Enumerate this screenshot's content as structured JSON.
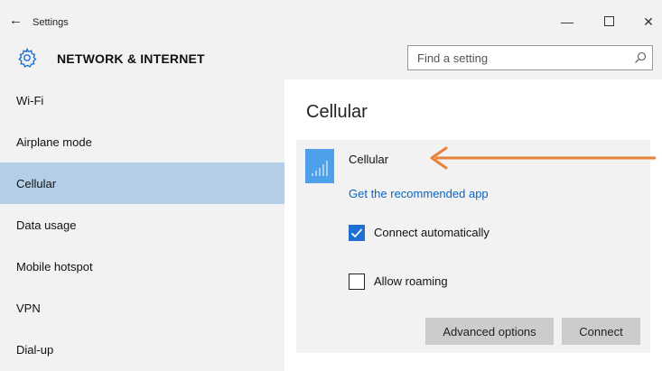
{
  "window": {
    "title": "Settings",
    "back_glyph": "←",
    "minimize_glyph": "—",
    "close_glyph": "✕"
  },
  "header": {
    "section_title": "NETWORK & INTERNET",
    "search_placeholder": "Find a setting"
  },
  "sidebar": {
    "items": [
      {
        "label": "Wi-Fi"
      },
      {
        "label": "Airplane mode"
      },
      {
        "label": "Cellular",
        "active": true
      },
      {
        "label": "Data usage"
      },
      {
        "label": "Mobile hotspot"
      },
      {
        "label": "VPN"
      },
      {
        "label": "Dial-up"
      }
    ]
  },
  "content": {
    "title": "Cellular",
    "card": {
      "connection_name": "Cellular",
      "link": "Get the recommended app",
      "connect_automatically": {
        "label": "Connect automatically",
        "checked": true
      },
      "allow_roaming": {
        "label": "Allow roaming",
        "checked": false
      },
      "advanced_button": "Advanced options",
      "connect_button": "Connect"
    }
  },
  "colors": {
    "accent": "#1e6fd1",
    "selected_nav": "#b4cee8",
    "tile": "#4ea0ea",
    "link": "#0a66c2",
    "annotation_arrow": "#e8823a"
  },
  "icons": {
    "back": "back-arrow-icon",
    "gear": "gear-icon",
    "search": "search-icon",
    "cellular": "cellular-signal-icon"
  }
}
